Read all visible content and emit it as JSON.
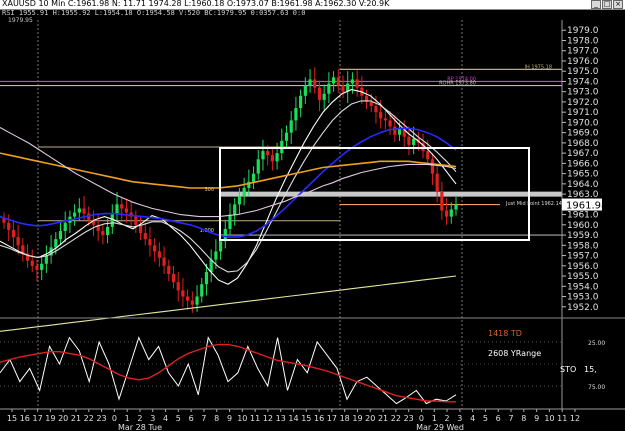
{
  "window": {
    "title": "XAUUSD 10 Min  C:1961.98  N: 11.71  1974.28  L:1960.18  O:1973.07  B:1961.98  A:1962.30  V:20.9K",
    "info": "RSI 1955.91  H:1955.92  L:1954.18  O:1954.58  V:520  BC:1979.95  0:0357.63  0:0",
    "buttons": [
      "_",
      "□",
      "×"
    ]
  },
  "chart_data": {
    "type": "candlestick",
    "title": "XAUUSD 10 Min",
    "y_axis": {
      "range": [
        1951.0,
        1980.0
      ],
      "ticks": [
        1952.0,
        1953.0,
        1954.0,
        1955.0,
        1956.0,
        1957.0,
        1958.0,
        1959.0,
        1960.0,
        1961.0,
        1962.0,
        1963.0,
        1964.0,
        1965.0,
        1966.0,
        1967.0,
        1968.0,
        1969.0,
        1970.0,
        1971.0,
        1972.0,
        1973.0,
        1974.0,
        1975.0,
        1976.0,
        1977.0,
        1978.0,
        1979.0
      ],
      "tick_labels": [
        "1952.0",
        "1953.0",
        "1954.0",
        "1955.0",
        "1956.0",
        "1957.0",
        "1958.0",
        "1959.0",
        "1960.0",
        "1961.0",
        "1962.0",
        "1963.0",
        "1964.0",
        "1965.0",
        "1966.0",
        "1967.0",
        "1968.0",
        "1969.0",
        "1970.0",
        "1971.0",
        "1972.0",
        "1973.0",
        "1974.0",
        "1975.0",
        "1976.0",
        "1977.0",
        "1978.0",
        "1979.0"
      ],
      "last_price": "1961.98"
    },
    "x_axis": {
      "hour_labels": [
        "15",
        "16",
        "17",
        "19",
        "20",
        "21",
        "22",
        "23",
        "0",
        "1",
        "2",
        "3",
        "4",
        "5",
        "6",
        "7",
        "8",
        "9",
        "10",
        "11",
        "12",
        "13",
        "14",
        "15",
        "16",
        "17",
        "18",
        "19",
        "20",
        "21",
        "22",
        "23",
        "0",
        "1",
        "2",
        "3",
        "4",
        "5",
        "6",
        "7",
        "8",
        "9",
        "10",
        "11",
        "12"
      ],
      "date_labels": [
        "Mar 28 Tue",
        "Mar 29 Wed"
      ]
    },
    "candles_close": [
      1960.2,
      1959.5,
      1958.8,
      1958.0,
      1957.2,
      1956.5,
      1956.0,
      1955.6,
      1956.2,
      1957.0,
      1957.8,
      1958.6,
      1959.4,
      1960.2,
      1960.8,
      1961.2,
      1961.6,
      1961.1,
      1960.5,
      1960.0,
      1959.4,
      1959.0,
      1959.8,
      1961.0,
      1962.0,
      1961.6,
      1961.2,
      1960.8,
      1960.0,
      1959.2,
      1958.6,
      1958.0,
      1957.4,
      1956.8,
      1956.0,
      1955.2,
      1954.4,
      1953.6,
      1953.0,
      1952.6,
      1952.2,
      1953.0,
      1954.2,
      1955.4,
      1956.6,
      1957.4,
      1958.4,
      1959.6,
      1961.0,
      1962.0,
      1962.8,
      1963.6,
      1964.2,
      1965.0,
      1966.4,
      1967.2,
      1966.8,
      1966.2,
      1967.0,
      1968.2,
      1969.0,
      1970.2,
      1971.4,
      1972.6,
      1973.6,
      1974.2,
      1973.4,
      1972.2,
      1972.8,
      1973.8,
      1974.4,
      1973.6,
      1973.0,
      1973.8,
      1974.2,
      1973.4,
      1972.6,
      1972.0,
      1971.6,
      1971.0,
      1970.4,
      1970.2,
      1969.6,
      1968.8,
      1969.4,
      1968.6,
      1967.8,
      1968.4,
      1968.0,
      1967.2,
      1966.4,
      1965.0,
      1963.2,
      1961.4,
      1960.8,
      1961.5,
      1961.98
    ],
    "moving_averages": [
      {
        "color": "#ffffff",
        "values": [
          1958.4,
          1957.9,
          1957.4,
          1957.0,
          1956.8,
          1957.2,
          1957.8,
          1958.6,
          1959.2,
          1959.9,
          1960.5,
          1960.8,
          1960.5,
          1960.0,
          1959.6,
          1960.2,
          1960.9,
          1960.6,
          1959.8,
          1959.0,
          1958.0,
          1956.8,
          1955.6,
          1954.6,
          1954.2,
          1954.8,
          1956.2,
          1958.0,
          1960.2,
          1962.4,
          1964.4,
          1966.2,
          1968.0,
          1969.6,
          1971.0,
          1972.0,
          1972.8,
          1973.2,
          1973.0,
          1972.6,
          1971.8,
          1970.8,
          1969.8,
          1968.9,
          1968.2,
          1967.4,
          1966.4,
          1965.2,
          1964.0
        ]
      },
      {
        "color": "#dcdcdc",
        "values": [
          1958.0,
          1957.7,
          1957.3,
          1957.0,
          1956.8,
          1957.0,
          1957.5,
          1958.1,
          1958.7,
          1959.3,
          1959.8,
          1960.1,
          1960.2,
          1960.0,
          1959.8,
          1960.0,
          1960.3,
          1960.3,
          1959.9,
          1959.4,
          1958.7,
          1957.8,
          1956.8,
          1955.9,
          1955.4,
          1955.5,
          1956.3,
          1957.6,
          1959.3,
          1961.1,
          1962.9,
          1964.6,
          1966.2,
          1967.7,
          1969.0,
          1970.2,
          1971.1,
          1971.8,
          1972.1,
          1972.1,
          1971.7,
          1971.0,
          1970.2,
          1969.4,
          1968.6,
          1967.9,
          1967.1,
          1966.2,
          1965.2
        ]
      },
      {
        "color": "#2a2aff",
        "values": [
          1960.8,
          1960.5,
          1960.2,
          1960.0,
          1959.9,
          1960.0,
          1960.2,
          1960.4,
          1960.6,
          1960.8,
          1961.0,
          1961.1,
          1961.1,
          1961.0,
          1960.9,
          1960.8,
          1960.7,
          1960.6,
          1960.4,
          1960.2,
          1960.0,
          1959.7,
          1959.3,
          1959.0,
          1958.8,
          1958.8,
          1959.0,
          1959.4,
          1960.0,
          1960.8,
          1961.6,
          1962.5,
          1963.4,
          1964.3,
          1965.2,
          1966.0,
          1966.8,
          1967.5,
          1968.1,
          1968.6,
          1969.0,
          1969.3,
          1969.4,
          1969.4,
          1969.3,
          1969.0,
          1968.6,
          1968.0,
          1967.3
        ]
      },
      {
        "color": "#f0a020",
        "values": [
          1967.0,
          1966.8,
          1966.6,
          1966.4,
          1966.2,
          1966.0,
          1965.8,
          1965.6,
          1965.4,
          1965.2,
          1965.0,
          1964.8,
          1964.6,
          1964.4,
          1964.2,
          1964.1,
          1964.0,
          1963.9,
          1963.8,
          1963.7,
          1963.6,
          1963.6,
          1963.6,
          1963.6,
          1963.7,
          1963.8,
          1964.0,
          1964.2,
          1964.4,
          1964.6,
          1964.8,
          1965.0,
          1965.2,
          1965.4,
          1965.6,
          1965.7,
          1965.8,
          1965.9,
          1966.0,
          1966.1,
          1966.2,
          1966.2,
          1966.2,
          1966.2,
          1966.1,
          1966.0,
          1965.9,
          1965.8,
          1965.7
        ]
      },
      {
        "color": "#e0c8e0",
        "values": [
          1969.5,
          1969.0,
          1968.5,
          1968.0,
          1967.4,
          1966.8,
          1966.2,
          1965.6,
          1965.0,
          1964.5,
          1964.0,
          1963.5,
          1963.0,
          1962.6,
          1962.2,
          1961.9,
          1961.6,
          1961.4,
          1961.2,
          1961.0,
          1960.9,
          1960.8,
          1960.8,
          1960.8,
          1960.9,
          1961.0,
          1961.2,
          1961.4,
          1961.7,
          1962.0,
          1962.3,
          1962.7,
          1963.0,
          1963.4,
          1963.8,
          1964.1,
          1964.5,
          1964.8,
          1965.1,
          1965.3,
          1965.5,
          1965.7,
          1965.8,
          1965.9,
          1965.9,
          1965.9,
          1965.8,
          1965.7,
          1965.5
        ]
      },
      {
        "color": "#e6e6a0",
        "values": [
          1949.6,
          1949.8,
          1950.0,
          1950.2,
          1950.4,
          1950.6,
          1950.8,
          1951.0,
          1951.2,
          1951.4,
          1951.6,
          1951.8,
          1952.0,
          1952.2,
          1952.4,
          1952.6,
          1952.8,
          1953.0,
          1953.2,
          1953.4,
          1953.6,
          1953.8,
          1954.0,
          1954.2,
          1954.4,
          1954.6,
          1954.8,
          1955.0
        ]
      }
    ],
    "horizontal_lines": [
      {
        "price": 1974.0,
        "color": "#d040d0",
        "label": "RP 1974.00"
      },
      {
        "price": 1973.6,
        "color": "#b8b8b8",
        "label": "ROHR 1973.80"
      },
      {
        "price": 1975.18,
        "color": "#bcaa88",
        "label": "IH 1975.18"
      },
      {
        "price": 1963.0,
        "color": "#d8d8d8",
        "label": "500"
      },
      {
        "price": 1959.0,
        "color": "#aaaaaa",
        "label": "1.000"
      },
      {
        "price": 1961.98,
        "color": "#ff9a60",
        "label": "Just Mid Point 1962.14"
      }
    ],
    "annotations": {
      "box_label": "Just Mid Point 1962.14",
      "top_left_value": "1979.95",
      "td_text": "1418 TD",
      "yrange_text": "2608 YRange",
      "sto_label": "STO",
      "sto_value": "15,"
    },
    "oscillator": {
      "y_ticks": [
        25.0,
        75.0
      ],
      "tick_labels": [
        "25.00",
        "75.00"
      ],
      "sto_fast": [
        60,
        45,
        70,
        55,
        80,
        30,
        50,
        20,
        35,
        70,
        25,
        50,
        90,
        55,
        20,
        45,
        30,
        60,
        75,
        50,
        85,
        20,
        40,
        70,
        60,
        30,
        55,
        75,
        20,
        80,
        45,
        60,
        25,
        40,
        55,
        90,
        70,
        65,
        75,
        85,
        95,
        88,
        80,
        95,
        90,
        92,
        85
      ],
      "sto_slow": [
        48,
        45,
        42,
        40,
        38,
        36,
        36,
        38,
        40,
        44,
        50,
        56,
        62,
        66,
        68,
        66,
        60,
        52,
        44,
        38,
        34,
        30,
        28,
        28,
        30,
        34,
        38,
        42,
        46,
        48,
        50,
        52,
        55,
        58,
        62,
        66,
        70,
        74,
        78,
        82,
        86,
        88,
        90,
        92,
        92,
        93,
        93
      ]
    }
  }
}
